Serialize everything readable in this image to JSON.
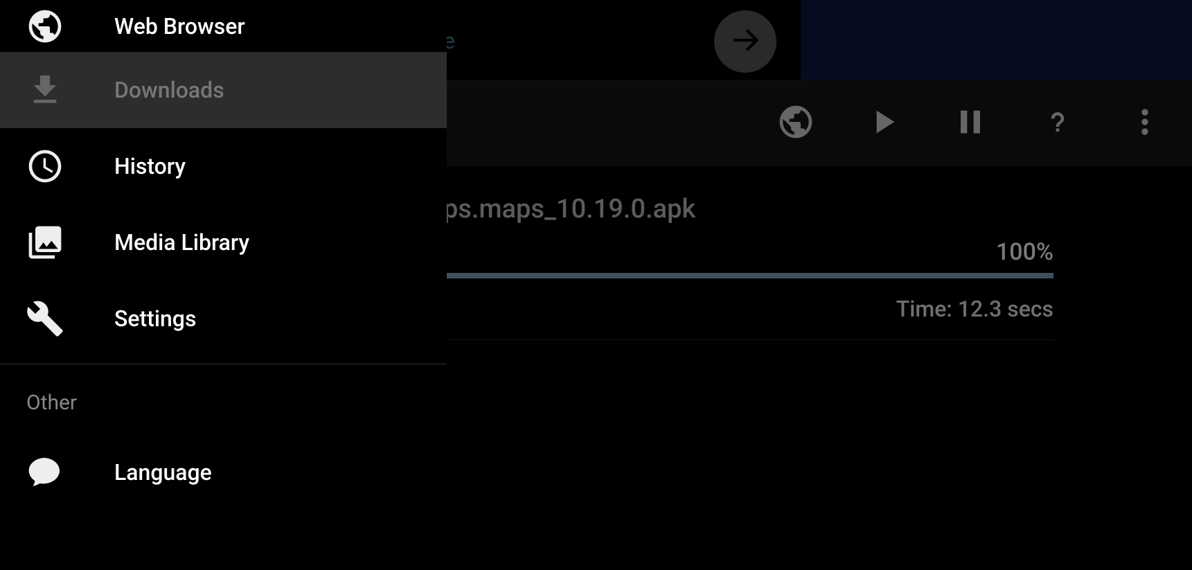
{
  "topbar": {
    "partial_text": "e"
  },
  "toolbar": {
    "icons": [
      "globe",
      "play",
      "pause",
      "help",
      "more"
    ]
  },
  "download": {
    "filename_visible": "ps.maps_10.19.0.apk",
    "percent": "100%",
    "time_label": "Time: 12.3 secs"
  },
  "sidebar": {
    "items": [
      {
        "label": "Web Browser",
        "icon": "globe"
      },
      {
        "label": "Downloads",
        "icon": "download",
        "selected": true
      },
      {
        "label": "History",
        "icon": "clock"
      },
      {
        "label": "Media Library",
        "icon": "media"
      },
      {
        "label": "Settings",
        "icon": "wrench"
      }
    ],
    "section_header": "Other",
    "other_items": [
      {
        "label": "Language",
        "icon": "speech"
      }
    ]
  }
}
